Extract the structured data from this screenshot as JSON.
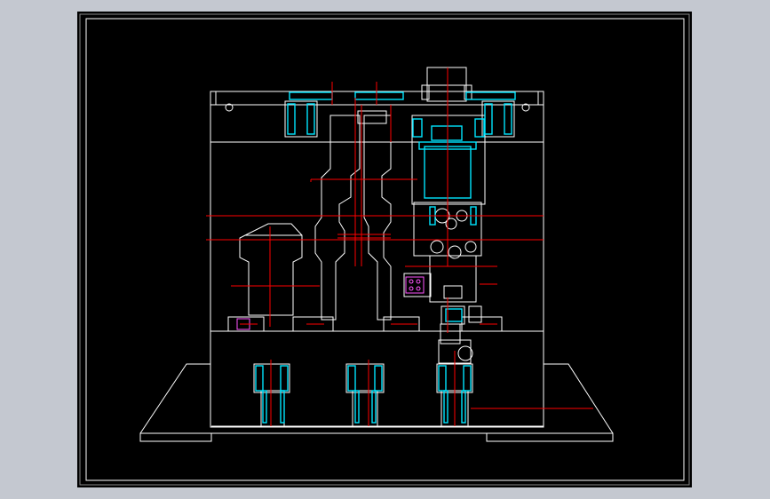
{
  "viewer": {
    "background": "#c4c8d0",
    "canvas_color": "#000000",
    "frame_color": "#ffffff"
  },
  "drawing": {
    "line_colors": {
      "outline": "#ffffff",
      "centerline": "#ff0000",
      "section": "#00e5ff",
      "detail": "#ff55ff"
    },
    "labels": []
  }
}
